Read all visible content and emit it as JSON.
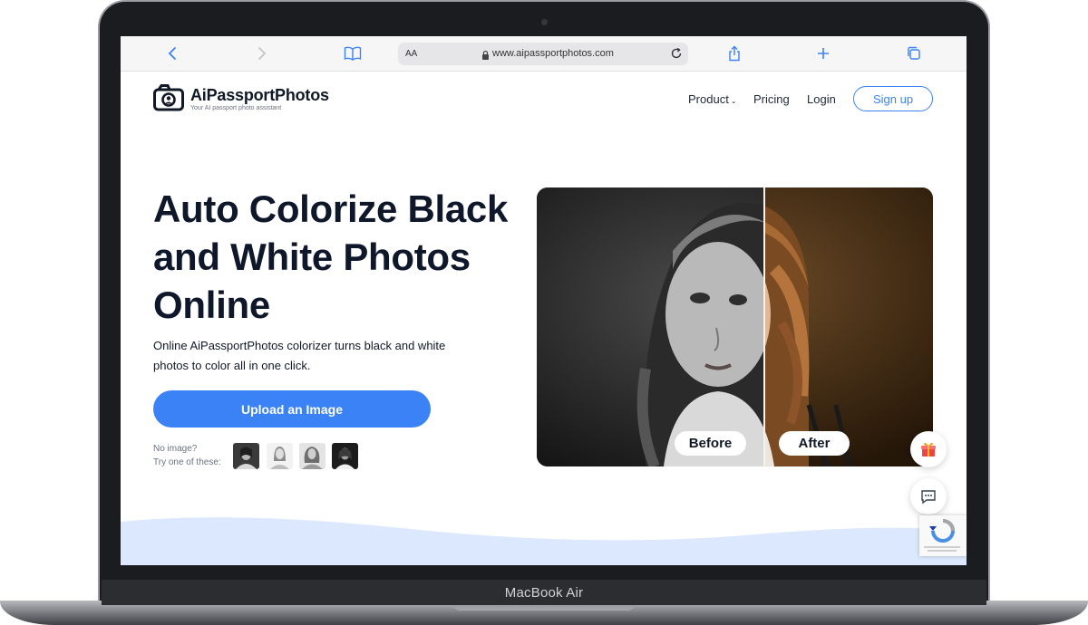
{
  "device": {
    "label": "MacBook Air"
  },
  "browser": {
    "address_prefix": "AA",
    "url": "www.aipassportphotos.com"
  },
  "site": {
    "logo_name": "AiPassportPhotos",
    "logo_tagline": "Your AI passport photo assistant",
    "nav": {
      "product": "Product",
      "pricing": "Pricing",
      "login": "Login",
      "signup": "Sign up"
    }
  },
  "hero": {
    "title_line1": "Auto Colorize Black",
    "title_line2": "and White Photos",
    "title_line3": "Online",
    "subtitle_line1": "Online AiPassportPhotos colorizer turns black and white",
    "subtitle_line2": "photos to color all in one click.",
    "upload_label": "Upload an Image",
    "no_image_line1": "No image?",
    "no_image_line2": "Try one of these:"
  },
  "compare": {
    "before_label": "Before",
    "after_label": "After"
  },
  "colors": {
    "accent": "#3b82f6",
    "heading": "#0f172a",
    "wave": "#dbe8fd"
  },
  "icons": [
    "back-icon",
    "forward-icon",
    "reader-icon",
    "lock-icon",
    "reload-icon",
    "share-icon",
    "new-tab-icon",
    "tabs-icon",
    "camera-logo-icon",
    "gift-icon",
    "chat-icon",
    "recaptcha-icon"
  ]
}
